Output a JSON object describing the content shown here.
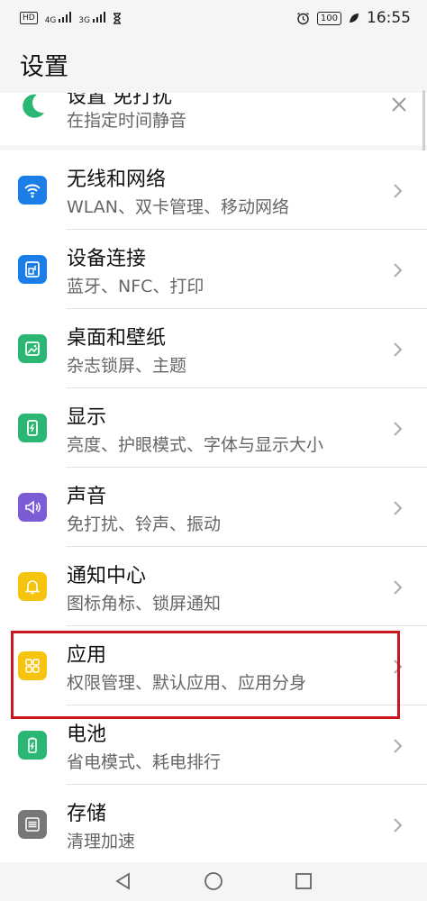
{
  "status_bar": {
    "left_indicators": [
      "HD",
      "4G",
      "3G"
    ],
    "time": "16:55",
    "battery": "100"
  },
  "page": {
    "title": "设置"
  },
  "top_card": {
    "title": "设置 免打扰",
    "subtitle": "在指定时间静音",
    "icon": "moon-icon",
    "icon_color": "#2bb673"
  },
  "items": [
    {
      "title": "无线和网络",
      "subtitle": "WLAN、双卡管理、移动网络",
      "icon": "wifi-icon",
      "color": "#1a7de8"
    },
    {
      "title": "设备连接",
      "subtitle": "蓝牙、NFC、打印",
      "icon": "device-connect-icon",
      "color": "#1a7de8"
    },
    {
      "title": "桌面和壁纸",
      "subtitle": "杂志锁屏、主题",
      "icon": "wallpaper-icon",
      "color": "#2bb673"
    },
    {
      "title": "显示",
      "subtitle": "亮度、护眼模式、字体与显示大小",
      "icon": "display-icon",
      "color": "#2bb673"
    },
    {
      "title": "声音",
      "subtitle": "免打扰、铃声、振动",
      "icon": "speaker-icon",
      "color": "#7b5cd6"
    },
    {
      "title": "通知中心",
      "subtitle": "图标角标、锁屏通知",
      "icon": "bell-icon",
      "color": "#f6c40f"
    },
    {
      "title": "应用",
      "subtitle": "权限管理、默认应用、应用分身",
      "icon": "apps-icon",
      "color": "#f6c40f"
    },
    {
      "title": "电池",
      "subtitle": "省电模式、耗电排行",
      "icon": "battery-icon",
      "color": "#2bb673"
    },
    {
      "title": "存储",
      "subtitle": "清理加速",
      "icon": "storage-icon",
      "color": "#777777"
    }
  ],
  "highlight_color": "#c8161d"
}
